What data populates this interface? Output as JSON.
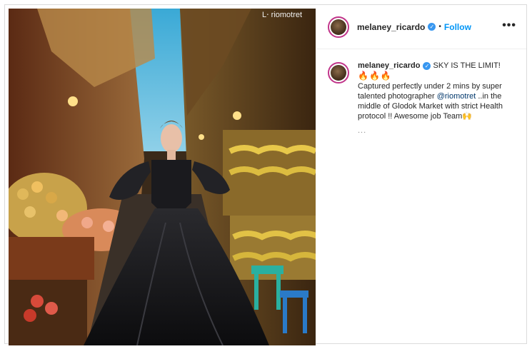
{
  "post": {
    "watermark": "L⋅ riomotret",
    "username": "melaney_ricardo",
    "follow_label": "Follow",
    "separator": "•",
    "more_label": "•••",
    "verified_mark": "✓",
    "caption_title": "SKY IS THE LIMIT!",
    "caption_emojis": "🔥🔥🔥",
    "caption_line1": "Captured perfectly under 2 mins by super talented photographer",
    "mention": "@riomotret",
    "caption_line2": " ..in the middle of Glodok Market with strict Health protocol !! Awesome job Team",
    "caption_end_emoji": "🙌",
    "truncation": "..."
  },
  "colors": {
    "accent_blue": "#0095f6",
    "verified_blue": "#3897f0",
    "story_ring": "#c1358a",
    "mention": "#00376b"
  },
  "icons": [
    "verified-badge-icon",
    "more-options-icon"
  ]
}
